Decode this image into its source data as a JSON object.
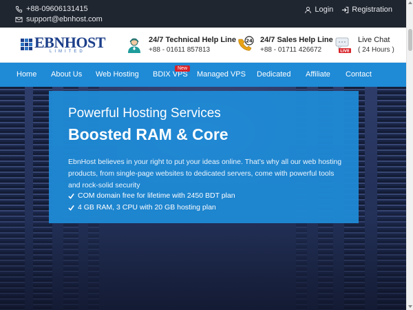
{
  "topbar": {
    "phone": "+88-09606131415",
    "email": "support@ebnhost.com",
    "login_label": "Login",
    "registration_label": "Registration"
  },
  "logo": {
    "word_part1": "EBN",
    "word_part2": "HOST",
    "subline": "LIMITED"
  },
  "help": {
    "tech_title": "24/7 Technical Help Line",
    "tech_phone": "+88 - 01611 857813",
    "sales_title": "24/7 Sales Help Line",
    "sales_phone": "+88 - 01711 426672",
    "chat_title": "Live Chat",
    "chat_sub": "( 24 Hours )",
    "live_badge": "LIVE",
    "sales_icon_badge": "24"
  },
  "nav": {
    "items": [
      "Home",
      "About Us",
      "Web Hosting",
      "BDIX VPS",
      "Managed VPS",
      "Dedicated",
      "Affiliate",
      "Contact"
    ],
    "new_badge": "New"
  },
  "hero": {
    "kicker": "Powerful Hosting Services",
    "headline": "Boosted RAM & Core",
    "description": "EbnHost believes in your right to put your ideas online. That’s why all our web hosting products, from single-page websites to dedicated servers, come with powerful tools and rock-solid security",
    "features": [
      "COM domain free for lifetime with 2450 BDT plan",
      "4 GB RAM, 3 CPU with 20 GB hosting plan"
    ]
  },
  "colors": {
    "topbar_bg": "#20262f",
    "nav_bg": "#1f8ad6",
    "brand_blue": "#1c3f8a",
    "badge_red": "#d8232a"
  }
}
